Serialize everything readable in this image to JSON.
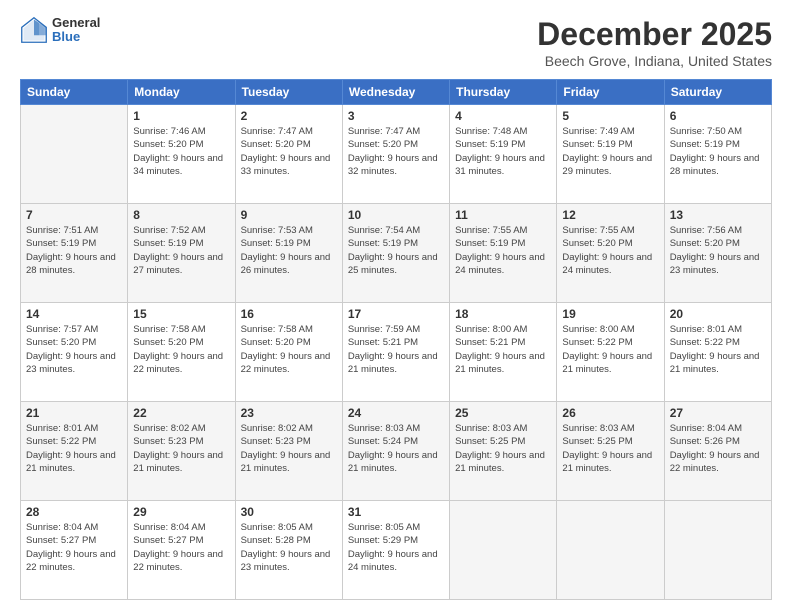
{
  "logo": {
    "general": "General",
    "blue": "Blue"
  },
  "header": {
    "title": "December 2025",
    "subtitle": "Beech Grove, Indiana, United States"
  },
  "weekdays": [
    "Sunday",
    "Monday",
    "Tuesday",
    "Wednesday",
    "Thursday",
    "Friday",
    "Saturday"
  ],
  "weeks": [
    [
      {
        "day": "",
        "sunrise": "",
        "sunset": "",
        "daylight": ""
      },
      {
        "day": "1",
        "sunrise": "Sunrise: 7:46 AM",
        "sunset": "Sunset: 5:20 PM",
        "daylight": "Daylight: 9 hours and 34 minutes."
      },
      {
        "day": "2",
        "sunrise": "Sunrise: 7:47 AM",
        "sunset": "Sunset: 5:20 PM",
        "daylight": "Daylight: 9 hours and 33 minutes."
      },
      {
        "day": "3",
        "sunrise": "Sunrise: 7:47 AM",
        "sunset": "Sunset: 5:20 PM",
        "daylight": "Daylight: 9 hours and 32 minutes."
      },
      {
        "day": "4",
        "sunrise": "Sunrise: 7:48 AM",
        "sunset": "Sunset: 5:19 PM",
        "daylight": "Daylight: 9 hours and 31 minutes."
      },
      {
        "day": "5",
        "sunrise": "Sunrise: 7:49 AM",
        "sunset": "Sunset: 5:19 PM",
        "daylight": "Daylight: 9 hours and 29 minutes."
      },
      {
        "day": "6",
        "sunrise": "Sunrise: 7:50 AM",
        "sunset": "Sunset: 5:19 PM",
        "daylight": "Daylight: 9 hours and 28 minutes."
      }
    ],
    [
      {
        "day": "7",
        "sunrise": "Sunrise: 7:51 AM",
        "sunset": "Sunset: 5:19 PM",
        "daylight": "Daylight: 9 hours and 28 minutes."
      },
      {
        "day": "8",
        "sunrise": "Sunrise: 7:52 AM",
        "sunset": "Sunset: 5:19 PM",
        "daylight": "Daylight: 9 hours and 27 minutes."
      },
      {
        "day": "9",
        "sunrise": "Sunrise: 7:53 AM",
        "sunset": "Sunset: 5:19 PM",
        "daylight": "Daylight: 9 hours and 26 minutes."
      },
      {
        "day": "10",
        "sunrise": "Sunrise: 7:54 AM",
        "sunset": "Sunset: 5:19 PM",
        "daylight": "Daylight: 9 hours and 25 minutes."
      },
      {
        "day": "11",
        "sunrise": "Sunrise: 7:55 AM",
        "sunset": "Sunset: 5:19 PM",
        "daylight": "Daylight: 9 hours and 24 minutes."
      },
      {
        "day": "12",
        "sunrise": "Sunrise: 7:55 AM",
        "sunset": "Sunset: 5:20 PM",
        "daylight": "Daylight: 9 hours and 24 minutes."
      },
      {
        "day": "13",
        "sunrise": "Sunrise: 7:56 AM",
        "sunset": "Sunset: 5:20 PM",
        "daylight": "Daylight: 9 hours and 23 minutes."
      }
    ],
    [
      {
        "day": "14",
        "sunrise": "Sunrise: 7:57 AM",
        "sunset": "Sunset: 5:20 PM",
        "daylight": "Daylight: 9 hours and 23 minutes."
      },
      {
        "day": "15",
        "sunrise": "Sunrise: 7:58 AM",
        "sunset": "Sunset: 5:20 PM",
        "daylight": "Daylight: 9 hours and 22 minutes."
      },
      {
        "day": "16",
        "sunrise": "Sunrise: 7:58 AM",
        "sunset": "Sunset: 5:20 PM",
        "daylight": "Daylight: 9 hours and 22 minutes."
      },
      {
        "day": "17",
        "sunrise": "Sunrise: 7:59 AM",
        "sunset": "Sunset: 5:21 PM",
        "daylight": "Daylight: 9 hours and 21 minutes."
      },
      {
        "day": "18",
        "sunrise": "Sunrise: 8:00 AM",
        "sunset": "Sunset: 5:21 PM",
        "daylight": "Daylight: 9 hours and 21 minutes."
      },
      {
        "day": "19",
        "sunrise": "Sunrise: 8:00 AM",
        "sunset": "Sunset: 5:22 PM",
        "daylight": "Daylight: 9 hours and 21 minutes."
      },
      {
        "day": "20",
        "sunrise": "Sunrise: 8:01 AM",
        "sunset": "Sunset: 5:22 PM",
        "daylight": "Daylight: 9 hours and 21 minutes."
      }
    ],
    [
      {
        "day": "21",
        "sunrise": "Sunrise: 8:01 AM",
        "sunset": "Sunset: 5:22 PM",
        "daylight": "Daylight: 9 hours and 21 minutes."
      },
      {
        "day": "22",
        "sunrise": "Sunrise: 8:02 AM",
        "sunset": "Sunset: 5:23 PM",
        "daylight": "Daylight: 9 hours and 21 minutes."
      },
      {
        "day": "23",
        "sunrise": "Sunrise: 8:02 AM",
        "sunset": "Sunset: 5:23 PM",
        "daylight": "Daylight: 9 hours and 21 minutes."
      },
      {
        "day": "24",
        "sunrise": "Sunrise: 8:03 AM",
        "sunset": "Sunset: 5:24 PM",
        "daylight": "Daylight: 9 hours and 21 minutes."
      },
      {
        "day": "25",
        "sunrise": "Sunrise: 8:03 AM",
        "sunset": "Sunset: 5:25 PM",
        "daylight": "Daylight: 9 hours and 21 minutes."
      },
      {
        "day": "26",
        "sunrise": "Sunrise: 8:03 AM",
        "sunset": "Sunset: 5:25 PM",
        "daylight": "Daylight: 9 hours and 21 minutes."
      },
      {
        "day": "27",
        "sunrise": "Sunrise: 8:04 AM",
        "sunset": "Sunset: 5:26 PM",
        "daylight": "Daylight: 9 hours and 22 minutes."
      }
    ],
    [
      {
        "day": "28",
        "sunrise": "Sunrise: 8:04 AM",
        "sunset": "Sunset: 5:27 PM",
        "daylight": "Daylight: 9 hours and 22 minutes."
      },
      {
        "day": "29",
        "sunrise": "Sunrise: 8:04 AM",
        "sunset": "Sunset: 5:27 PM",
        "daylight": "Daylight: 9 hours and 22 minutes."
      },
      {
        "day": "30",
        "sunrise": "Sunrise: 8:05 AM",
        "sunset": "Sunset: 5:28 PM",
        "daylight": "Daylight: 9 hours and 23 minutes."
      },
      {
        "day": "31",
        "sunrise": "Sunrise: 8:05 AM",
        "sunset": "Sunset: 5:29 PM",
        "daylight": "Daylight: 9 hours and 24 minutes."
      },
      {
        "day": "",
        "sunrise": "",
        "sunset": "",
        "daylight": ""
      },
      {
        "day": "",
        "sunrise": "",
        "sunset": "",
        "daylight": ""
      },
      {
        "day": "",
        "sunrise": "",
        "sunset": "",
        "daylight": ""
      }
    ]
  ]
}
